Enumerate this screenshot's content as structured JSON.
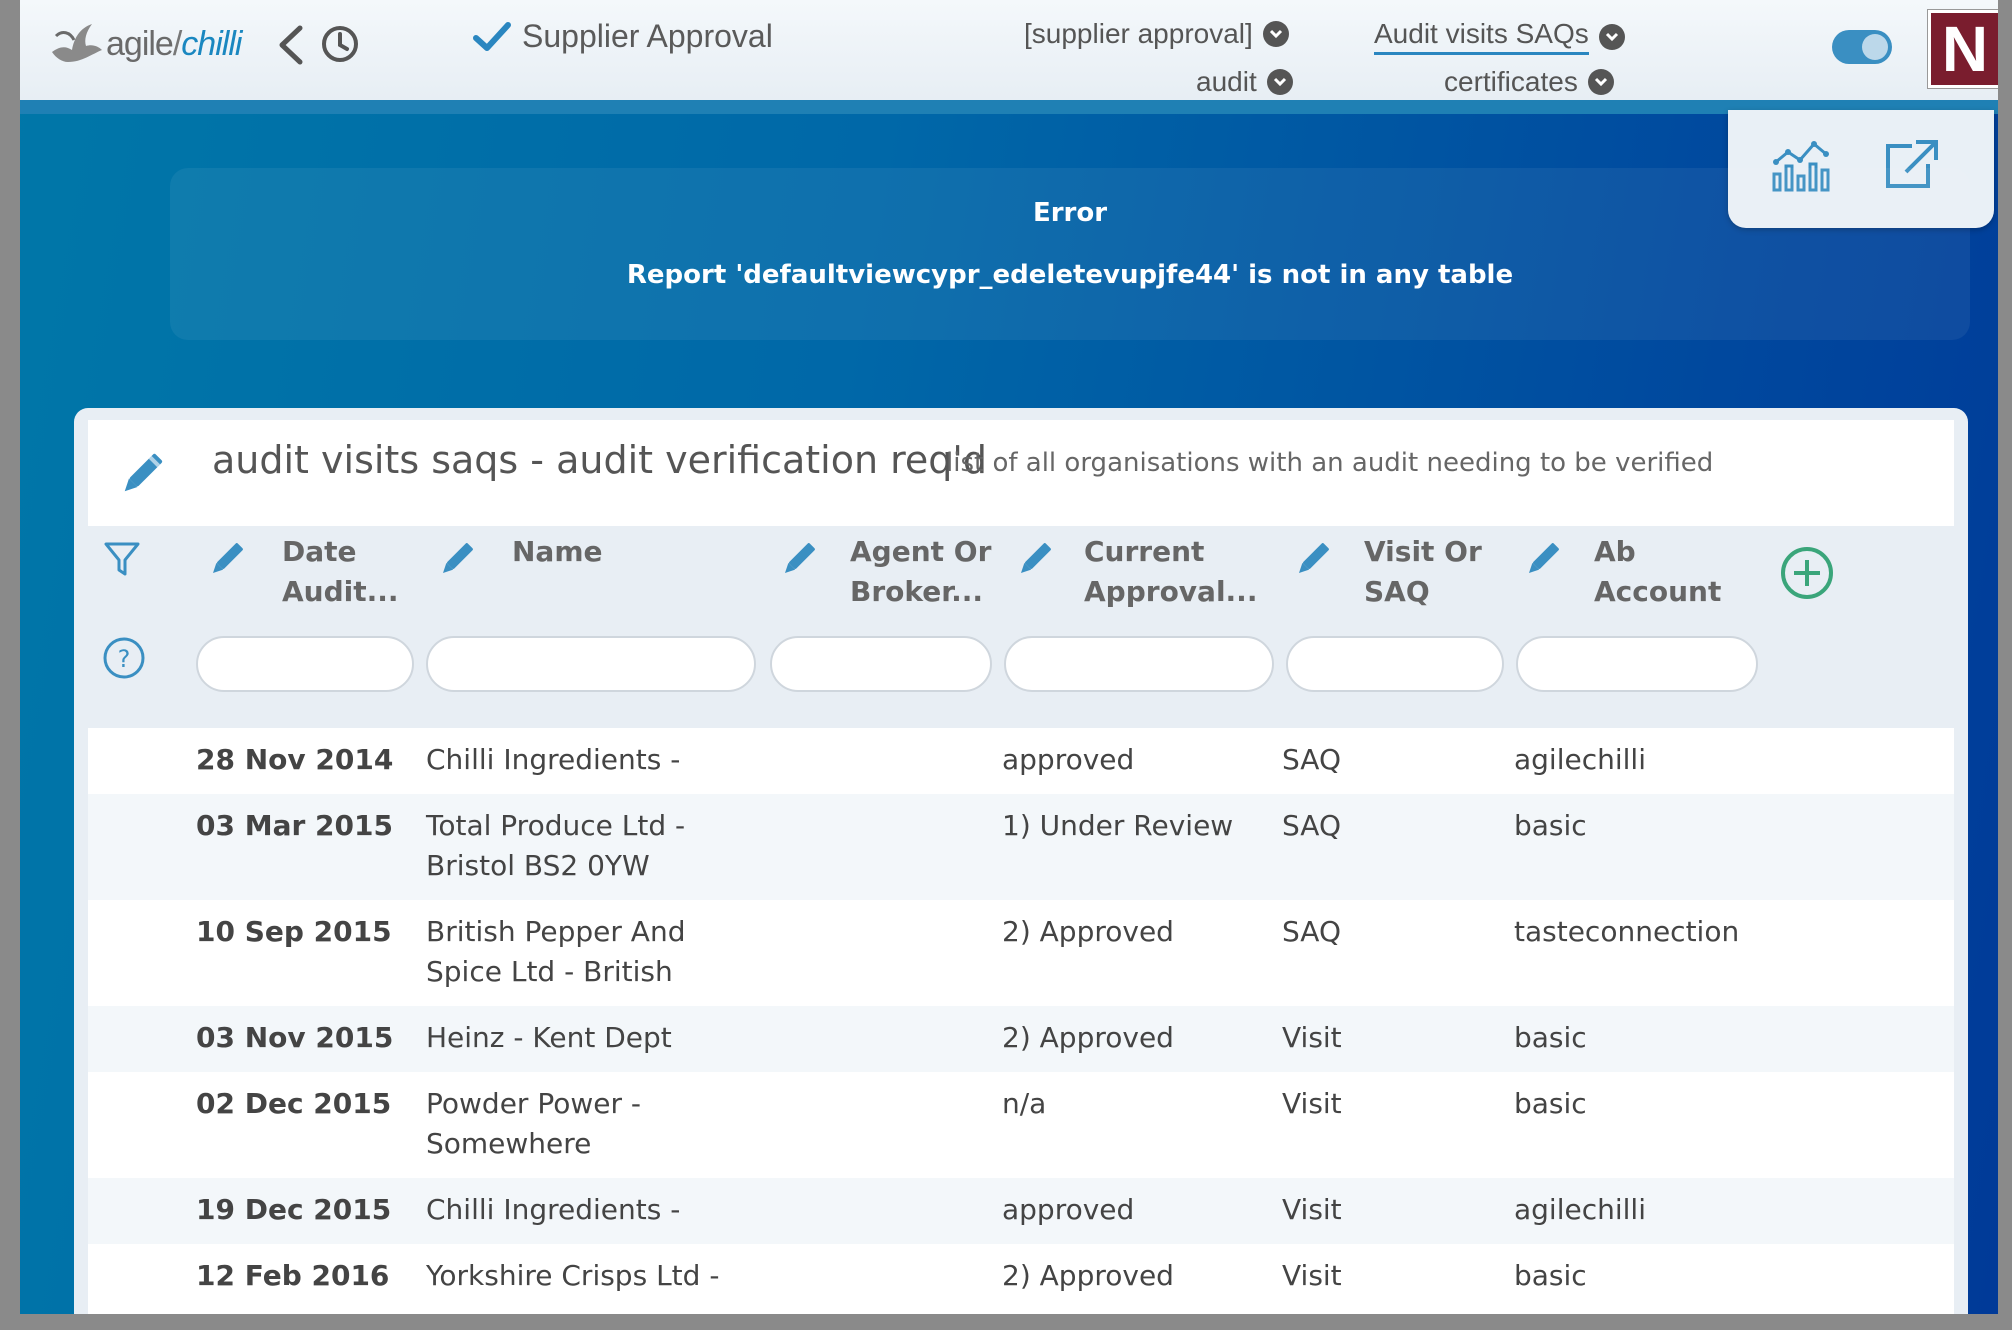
{
  "header": {
    "logo_text_a": "agile",
    "logo_text_sep": "/",
    "logo_text_b": "chilli",
    "app_title": "Supplier Approval",
    "nav": [
      {
        "label": "[supplier approval]"
      },
      {
        "label": "Audit visits SAQs"
      },
      {
        "label": "audit"
      },
      {
        "label": "certificates"
      }
    ],
    "user_badge": "N"
  },
  "error": {
    "title": "Error",
    "message": "Report 'defaultviewcypr_edeletevupjfe44' is not in any table"
  },
  "report": {
    "title": "audit visits saqs - audit verification req'd",
    "description": "list of all organisations with an audit needing to be verified",
    "columns": [
      {
        "line1": "Date",
        "line2": "Audit..."
      },
      {
        "line1": "Name",
        "line2": ""
      },
      {
        "line1": "Agent Or",
        "line2": "Broker..."
      },
      {
        "line1": "Current",
        "line2": "Approval..."
      },
      {
        "line1": "Visit Or",
        "line2": "SAQ"
      },
      {
        "line1": "Ab",
        "line2": "Account"
      }
    ],
    "rows": [
      {
        "date": "28 Nov 2014",
        "name1": "Chilli Ingredients -",
        "name2": "",
        "status": "approved",
        "type": "SAQ",
        "account": "agilechilli"
      },
      {
        "date": "03 Mar 2015",
        "name1": "Total Produce Ltd -",
        "name2": "Bristol BS2 0YW",
        "status": "1) Under Review",
        "type": "SAQ",
        "account": "basic"
      },
      {
        "date": "10 Sep 2015",
        "name1": "British Pepper And",
        "name2": "Spice Ltd - British",
        "status": "2) Approved",
        "type": "SAQ",
        "account": "tasteconnection"
      },
      {
        "date": "03 Nov 2015",
        "name1": "Heinz - Kent Dept",
        "name2": "",
        "status": "2) Approved",
        "type": "Visit",
        "account": "basic"
      },
      {
        "date": "02 Dec 2015",
        "name1": "Powder Power -",
        "name2": "Somewhere",
        "status": "n/a",
        "type": "Visit",
        "account": "basic"
      },
      {
        "date": "19 Dec 2015",
        "name1": "Chilli Ingredients -",
        "name2": "",
        "status": "approved",
        "type": "Visit",
        "account": "agilechilli"
      },
      {
        "date": "12 Feb 2016",
        "name1": "Yorkshire Crisps Ltd -",
        "name2": "",
        "status": "2) Approved",
        "type": "Visit",
        "account": "basic"
      }
    ]
  },
  "colors": {
    "accent": "#1a87c0",
    "add_icon": "#3aa57a",
    "badge": "#7a1d2e"
  }
}
